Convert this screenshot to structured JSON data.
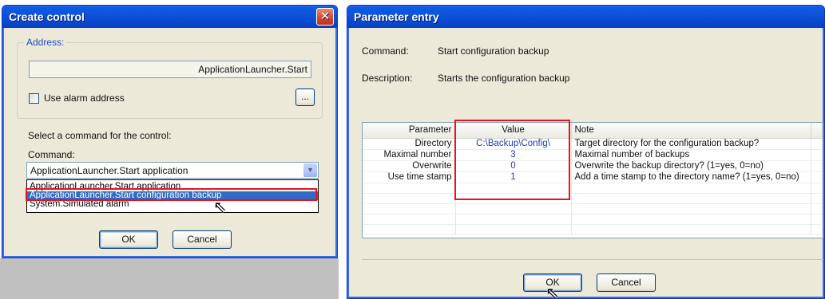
{
  "create_control": {
    "title": "Create control",
    "address_legend": "Address:",
    "address_value": "ApplicationLauncher.Start",
    "use_alarm_label": "Use alarm address",
    "browse_label": "...",
    "select_prompt": "Select a command for the control:",
    "command_label": "Command:",
    "command_selected": "ApplicationLauncher.Start application",
    "options": [
      "ApplicationLauncher.Start application",
      "ApplicationLauncher.Start configuration backup",
      "System.Simulated alarm"
    ],
    "ok_label": "OK",
    "cancel_label": "Cancel"
  },
  "parameter_entry": {
    "title": "Parameter entry",
    "command_label": "Command:",
    "command_value": "Start configuration backup",
    "description_label": "Description:",
    "description_value": "Starts the configuration backup",
    "columns": [
      "Parameter",
      "Value",
      "Note"
    ],
    "rows": [
      {
        "parameter": "Directory",
        "value": "C:\\Backup\\Config\\",
        "note": "Target directory for the configuration backup?"
      },
      {
        "parameter": "Maximal number",
        "value": "3",
        "note": "Maximal number of backups"
      },
      {
        "parameter": "Overwrite",
        "value": "0",
        "note": "Overwrite the backup directory? (1=yes, 0=no)"
      },
      {
        "parameter": "Use time stamp",
        "value": "1",
        "note": "Add a time stamp to the directory name? (1=yes, 0=no)"
      }
    ],
    "ok_label": "OK",
    "cancel_label": "Cancel"
  },
  "colors": {
    "titlebar": "#0a5ce8",
    "highlight": "#e8121c",
    "selection": "#316ac5",
    "value_text": "#1f3ec2"
  }
}
